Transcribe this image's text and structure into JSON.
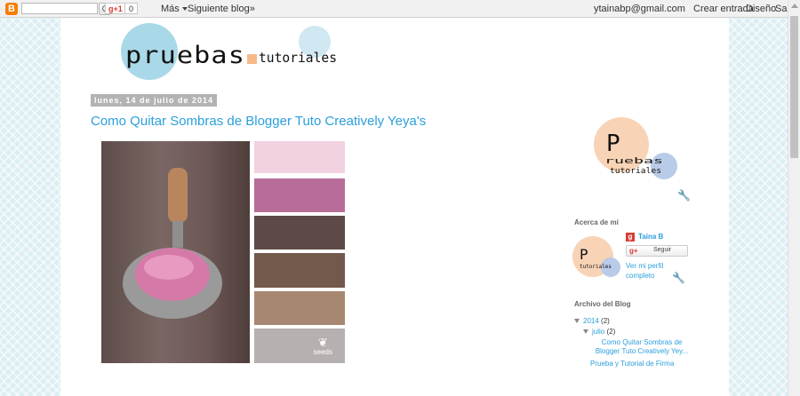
{
  "navbar": {
    "gplus_label": "g+1",
    "gplus_count": "0",
    "more_label": "Más",
    "next_blog_label": "Siguiente blog»",
    "email": "ytainabp@gmail.com",
    "create_label": "Crear entrada",
    "design_label": "Diseño",
    "logout_label": "Salir"
  },
  "header": {
    "logo_text": "pruebas y tutoriales"
  },
  "post": {
    "date": "lunes, 14 de julio de 2014",
    "title": "Como Quitar Sombras de Blogger Tuto Creatively Yeya's",
    "image_watermark": "seeds"
  },
  "swatches": [
    "#f2d1e1",
    "#b86d99",
    "#5b4a47",
    "#73584c",
    "#a88772",
    "#b6b1b0"
  ],
  "sidebar": {
    "logo_text": "Pruebas y Tutoriales",
    "about_heading": "Acerca de mí",
    "profile_name": "Taina B",
    "follow_label": "Seguir",
    "profile_link": "Ver mi perfil completo",
    "archive_heading": "Archivo del Blog",
    "archive_year": "2014",
    "archive_year_count": "(2)",
    "archive_month": "julio",
    "archive_month_count": "(2)",
    "archive_posts": [
      "Como Quitar Sombras de Blogger Tuto Creatively Yey...",
      "Prueba y Tutorial de Firma"
    ]
  }
}
